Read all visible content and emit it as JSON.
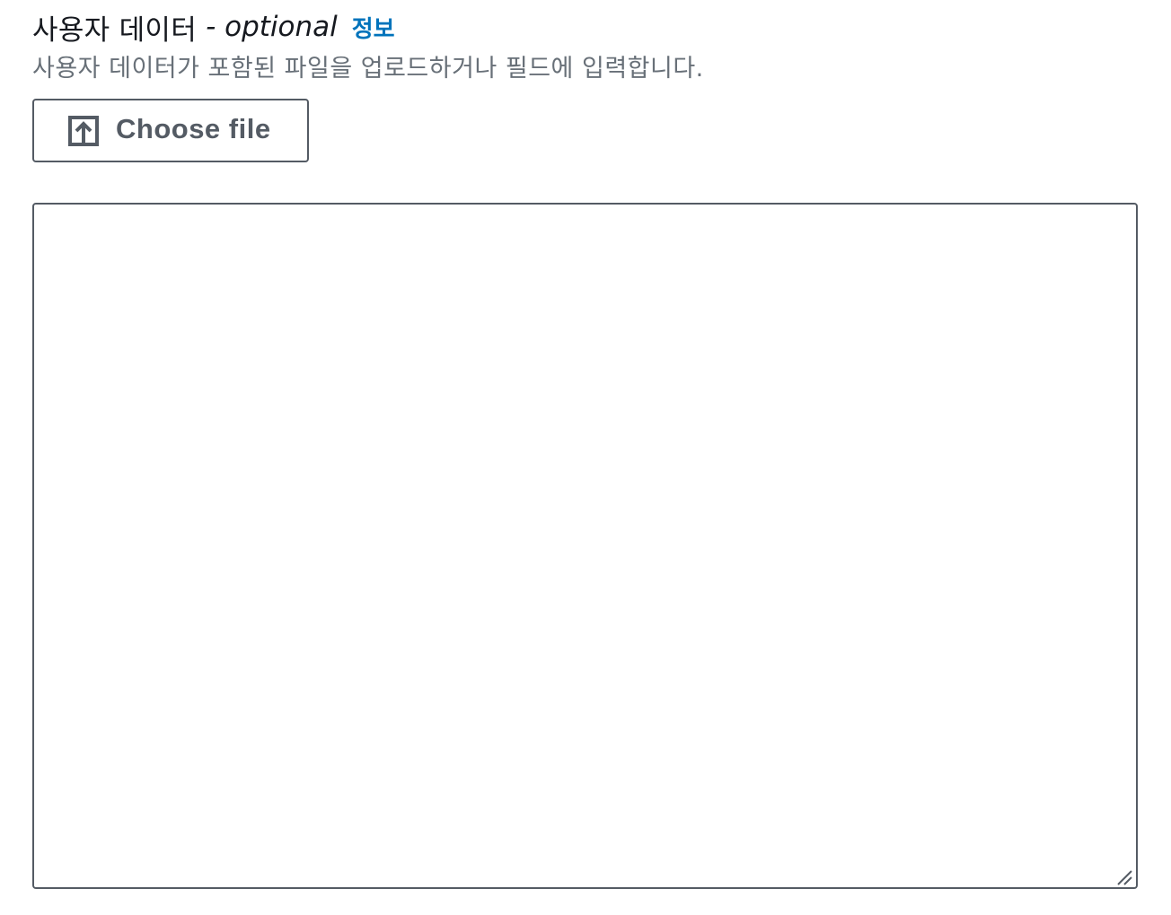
{
  "field": {
    "label": "사용자 데이터",
    "optional": "- optional",
    "info_link": "정보",
    "description": "사용자 데이터가 포함된 파일을 업로드하거나 필드에 입력합니다."
  },
  "upload_button": {
    "label": "Choose file",
    "icon": "upload-icon"
  },
  "textarea": {
    "value": "",
    "placeholder": ""
  },
  "colors": {
    "text": "#16191f",
    "secondary_text": "#687078",
    "link": "#0073bb",
    "border": "#545b64",
    "button_text": "#545b64"
  }
}
